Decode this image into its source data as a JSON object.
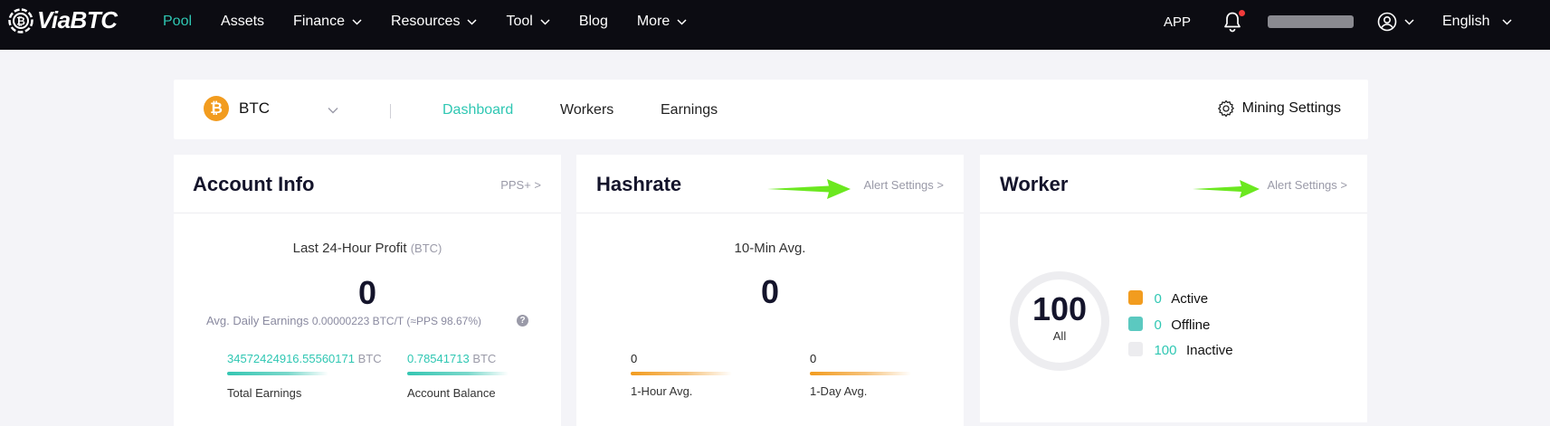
{
  "header": {
    "logo_text": "ViaBTC",
    "nav": [
      {
        "label": "Pool",
        "active": true,
        "has_dropdown": false
      },
      {
        "label": "Assets",
        "active": false,
        "has_dropdown": false
      },
      {
        "label": "Finance",
        "active": false,
        "has_dropdown": true
      },
      {
        "label": "Resources",
        "active": false,
        "has_dropdown": true
      },
      {
        "label": "Tool",
        "active": false,
        "has_dropdown": true
      },
      {
        "label": "Blog",
        "active": false,
        "has_dropdown": false
      },
      {
        "label": "More",
        "active": false,
        "has_dropdown": true
      }
    ],
    "app_label": "APP",
    "language": "English"
  },
  "subheader": {
    "coin": "BTC",
    "coin_symbol": "₿",
    "tabs": [
      {
        "label": "Dashboard",
        "active": true
      },
      {
        "label": "Workers",
        "active": false
      },
      {
        "label": "Earnings",
        "active": false
      }
    ],
    "mining_settings_label": "Mining Settings"
  },
  "account": {
    "title": "Account Info",
    "link": "PPS+ >",
    "profit_label": "Last 24-Hour Profit",
    "profit_unit": "(BTC)",
    "profit_value": "0",
    "avg_label": "Avg. Daily Earnings",
    "avg_value": "0.00000223 BTC/T (≈PPS 98.67%)",
    "help_icon": "?",
    "total_earnings_value": "34572424916.55560171",
    "total_earnings_unit": "BTC",
    "total_earnings_label": "Total Earnings",
    "balance_value": "0.78541713",
    "balance_unit": "BTC",
    "balance_label": "Account Balance"
  },
  "hashrate": {
    "title": "Hashrate",
    "link": "Alert Settings >",
    "avg10_label": "10-Min Avg.",
    "avg10_value": "0",
    "hour_value": "0",
    "hour_label": "1-Hour Avg.",
    "day_value": "0",
    "day_label": "1-Day Avg."
  },
  "worker": {
    "title": "Worker",
    "link": "Alert Settings >",
    "total": "100",
    "total_label": "All",
    "legend": [
      {
        "count": "0",
        "label": "Active",
        "color": "#f29c1f"
      },
      {
        "count": "0",
        "label": "Offline",
        "color": "#5bc9c0"
      },
      {
        "count": "100",
        "label": "Inactive",
        "color": "#ececef"
      }
    ]
  },
  "colors": {
    "accent": "#2fc7b3",
    "nav_bg": "#0c0c12",
    "btc_orange": "#f29c1f",
    "annotation_arrow": "#6be81f"
  }
}
